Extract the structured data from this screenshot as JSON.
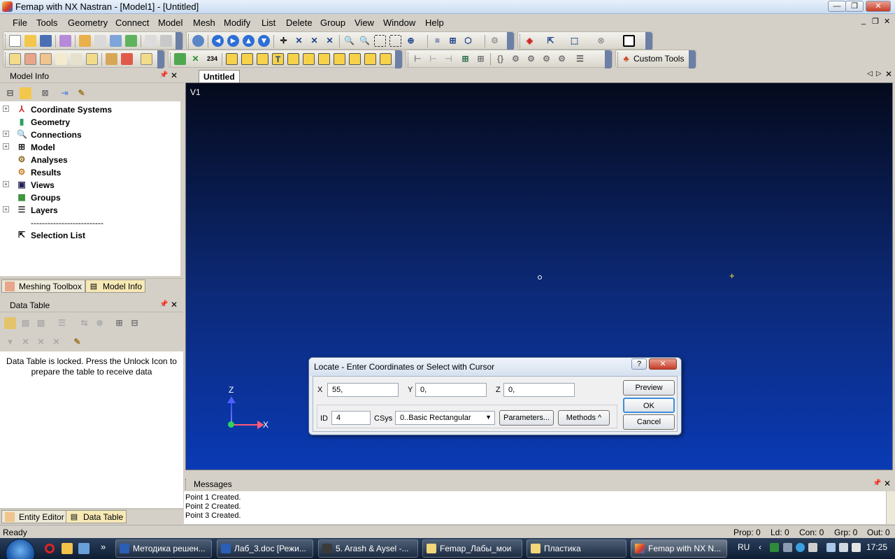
{
  "window": {
    "title": "Femap with NX Nastran - [Model1] - [Untitled]",
    "minimize": "—",
    "restore": "❐",
    "close": "✕"
  },
  "menu": [
    "File",
    "Tools",
    "Geometry",
    "Connect",
    "Model",
    "Mesh",
    "Modify",
    "List",
    "Delete",
    "Group",
    "View",
    "Window",
    "Help"
  ],
  "mdi_controls": {
    "minimize": "_",
    "restore": "❐",
    "close": "✕"
  },
  "toolbar": {
    "custom_tools_label": "Custom Tools",
    "counter_label": "234"
  },
  "model_info": {
    "title": "Model Info",
    "pin": "📌",
    "close": "✕",
    "tree": [
      {
        "label": "Coordinate Systems",
        "icon": "coordinate-systems-icon",
        "expand": "+"
      },
      {
        "label": "Geometry",
        "icon": "geometry-icon",
        "expand": ""
      },
      {
        "label": "Connections",
        "icon": "connections-icon",
        "expand": "+"
      },
      {
        "label": "Model",
        "icon": "model-icon",
        "expand": "+"
      },
      {
        "label": "Analyses",
        "icon": "analyses-icon",
        "expand": ""
      },
      {
        "label": "Results",
        "icon": "results-icon",
        "expand": ""
      },
      {
        "label": "Views",
        "icon": "views-icon",
        "expand": "+"
      },
      {
        "label": "Groups",
        "icon": "groups-icon",
        "expand": ""
      },
      {
        "label": "Layers",
        "icon": "layers-icon",
        "expand": "+"
      },
      {
        "label": "--------------------------",
        "icon": "",
        "expand": ""
      },
      {
        "label": "Selection List",
        "icon": "selection-list-icon",
        "expand": ""
      }
    ]
  },
  "upper_tabs": {
    "meshing_toolbox": "Meshing Toolbox",
    "model_info": "Model Info"
  },
  "data_table": {
    "title": "Data Table",
    "locked_message": "Data Table is locked. Press the Unlock Icon to prepare the table to receive data"
  },
  "lower_tabs": {
    "entity_editor": "Entity Editor",
    "data_table": "Data Table"
  },
  "document_tab": "Untitled",
  "viewport": {
    "view_label": "V1",
    "axis_z": "Z",
    "axis_x": "X"
  },
  "dialog": {
    "title": "Locate - Enter Coordinates or Select with Cursor",
    "help": "?",
    "close": "✕",
    "x_label": "X",
    "x_value": "55,",
    "y_label": "Y",
    "y_value": "0,",
    "z_label": "Z",
    "z_value": "0,",
    "id_label": "ID",
    "id_value": "4",
    "csys_label": "CSys",
    "csys_value": "0..Basic Rectangular",
    "parameters_button": "Parameters...",
    "methods_button": "Methods ^",
    "preview_button": "Preview",
    "ok_button": "OK",
    "cancel_button": "Cancel"
  },
  "messages": {
    "title": "Messages",
    "lines": [
      "Point 1 Created.",
      "Point 2 Created.",
      "Point 3 Created."
    ]
  },
  "status": {
    "ready": "Ready",
    "prop": "Prop: 0",
    "ld": "Ld: 0",
    "con": "Con: 0",
    "grp": "Grp: 0",
    "out": "Out: 0"
  },
  "taskbar": {
    "items": [
      "Методика решен...",
      "Лаб_3.doc [Режи...",
      "5. Arash & Aysel -...",
      "Femap_Лабы_мои",
      "Пластика",
      "Femap with NX N..."
    ],
    "language": "RU",
    "clock": "17:25",
    "more": "»"
  }
}
